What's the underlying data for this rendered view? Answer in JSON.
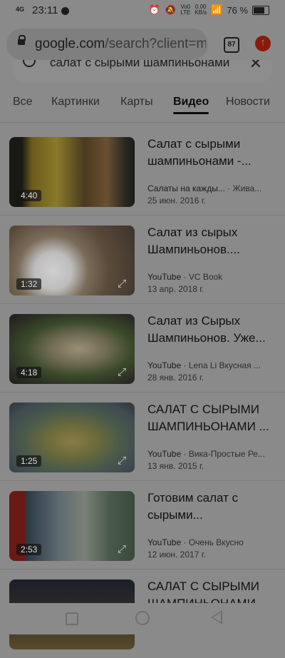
{
  "status": {
    "signal": "4G",
    "time": "23:11",
    "net_speed": "0.00",
    "net_unit": "KB/s",
    "volte": "Vo0",
    "lte": "LTE",
    "battery": "76 %"
  },
  "browser": {
    "url_host": "google.com",
    "url_rest": "/search?client=ms",
    "tab_count": "87"
  },
  "search": {
    "query": "салат с сырыми шампиньонами"
  },
  "tabs": [
    {
      "label": "Все"
    },
    {
      "label": "Картинки"
    },
    {
      "label": "Карты"
    },
    {
      "label": "Видео"
    },
    {
      "label": "Новости"
    }
  ],
  "results": [
    {
      "title": "Салат с сырыми шампиньонами -...",
      "duration": "4:40",
      "source": "Салаты на кажды...",
      "channel": "Жива...",
      "date": "25 июн. 2016 г."
    },
    {
      "title": "Салат из сырых Шампиньонов....",
      "duration": "1:32",
      "source": "YouTube",
      "channel": "VC Book",
      "date": "13 апр. 2018 г."
    },
    {
      "title": "Салат из Сырых Шампиньонов. Уже...",
      "duration": "4:18",
      "source": "YouTube",
      "channel": "Lena Li Вкусная ...",
      "date": "28 янв. 2016 г."
    },
    {
      "title": "САЛАТ С СЫРЫМИ ШАМПИНЬОНАМИ ...",
      "duration": "1:25",
      "source": "YouTube",
      "channel": "Вика-Простые Ре...",
      "date": "13 янв. 2015 г."
    },
    {
      "title": "Готовим салат с сырыми...",
      "duration": "2:53",
      "source": "YouTube",
      "channel": "Очень Вкусно",
      "date": "12 июн. 2017 г."
    },
    {
      "title": "САЛАТ С СЫРЫМИ ШАМПИНЬОНАМИ",
      "duration": "",
      "source": "",
      "channel": "",
      "date": ""
    }
  ],
  "colors": {
    "dim_overlay": "#8a8a8a",
    "update_button": "#8a1a0a"
  }
}
